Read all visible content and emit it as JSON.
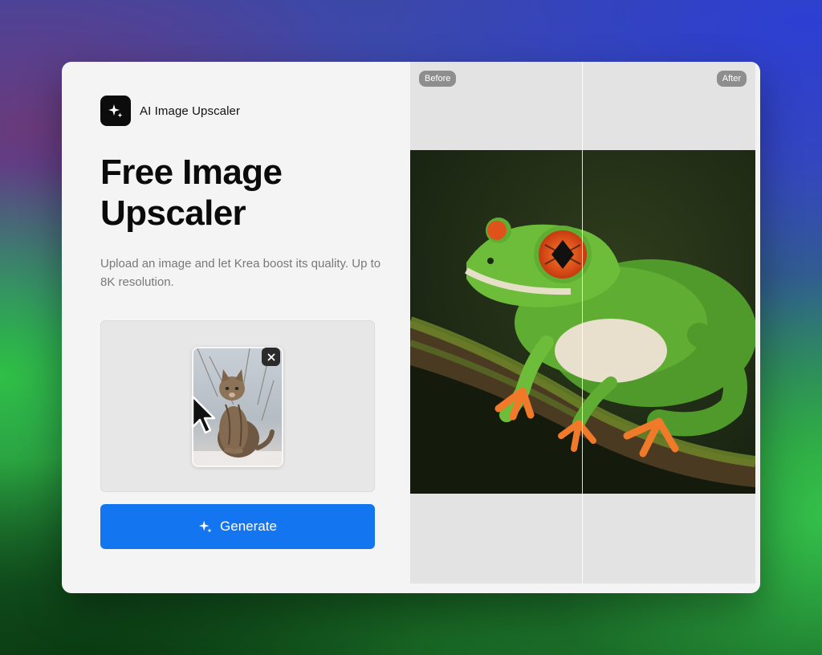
{
  "app": {
    "name": "AI Image Upscaler",
    "logo_icon": "sparkle-icon"
  },
  "hero": {
    "title": "Free Image Upscaler",
    "subtitle": "Upload an image and let Krea boost its quality. Up to 8K resolution."
  },
  "upload": {
    "thumbnail_subject": "cat photo",
    "remove_icon": "close-icon"
  },
  "actions": {
    "generate_label": "Generate",
    "generate_icon": "sparkle-icon"
  },
  "comparison": {
    "before_label": "Before",
    "after_label": "After",
    "subject": "green tree frog on mossy branch"
  },
  "colors": {
    "accent": "#1375f0",
    "panel_bg": "#f4f4f4",
    "badge_bg": "#8e8e8e"
  }
}
